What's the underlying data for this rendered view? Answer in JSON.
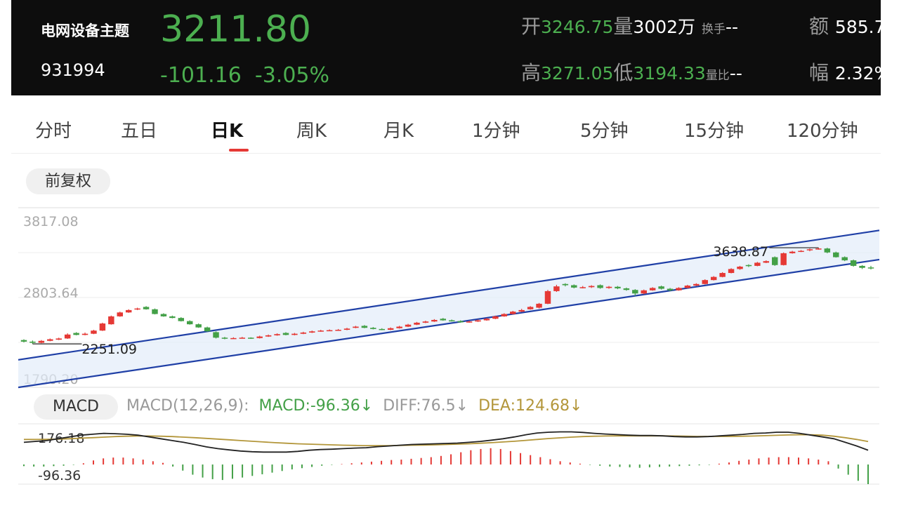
{
  "header": {
    "name": "电网设备主题",
    "code": "931994",
    "price": "3211.80",
    "change": "-101.16",
    "change_pct": "-3.05%",
    "open_label": "开",
    "open": "3246.75",
    "volume_label": "量",
    "volume": "3002万",
    "turnover_label": "换手",
    "turnover": "--",
    "amount_label": "额",
    "amount": "585.7",
    "high_label": "高",
    "high": "3271.05",
    "low_label": "低",
    "low": "3194.33",
    "vol_ratio_label": "量比",
    "vol_ratio": "--",
    "amplitude_label": "幅",
    "amplitude": "2.32%"
  },
  "tabs": [
    "分时",
    "五日",
    "日K",
    "周K",
    "月K",
    "1分钟",
    "5分钟",
    "15分钟",
    "120分钟"
  ],
  "active_tab": "日K",
  "adjust_label": "前复权",
  "colors": {
    "up": "#e53935",
    "down": "#43a047",
    "channel": "#1f3fa6",
    "diff": "#222222",
    "dea": "#b3963a"
  },
  "chart_data": [
    {
      "type": "candlestick",
      "ylim": [
        1790.2,
        3817.08
      ],
      "y_tick_labels": [
        "3817.08",
        "2803.64",
        "1790.20"
      ],
      "annotations": {
        "high": "3638.87",
        "low": "2251.09"
      },
      "trend_channel": {
        "upper": [
          [
            0,
            2050
          ],
          [
            100,
            3690
          ]
        ],
        "lower": [
          [
            0,
            1700
          ],
          [
            100,
            3320
          ]
        ]
      },
      "closes": [
        2280,
        2265,
        2290,
        2310,
        2320,
        2370,
        2365,
        2380,
        2420,
        2510,
        2600,
        2650,
        2680,
        2700,
        2690,
        2630,
        2600,
        2580,
        2540,
        2500,
        2460,
        2410,
        2330,
        2320,
        2325,
        2330,
        2320,
        2345,
        2360,
        2375,
        2365,
        2380,
        2395,
        2410,
        2420,
        2425,
        2430,
        2445,
        2470,
        2455,
        2440,
        2430,
        2450,
        2470,
        2495,
        2520,
        2535,
        2555,
        2550,
        2540,
        2525,
        2535,
        2550,
        2570,
        2600,
        2630,
        2660,
        2680,
        2720,
        2760,
        2920,
        2980,
        2995,
        2965,
        2970,
        2985,
        2960,
        2975,
        2955,
        2935,
        2890,
        2930,
        2960,
        2950,
        2930,
        2960,
        2990,
        3010,
        3060,
        3100,
        3150,
        3200,
        3230,
        3240,
        3280,
        3300,
        3250,
        3400,
        3420,
        3430,
        3450,
        3460,
        3410,
        3350,
        3310,
        3240,
        3215,
        3211.8
      ],
      "opens": [
        2300,
        2280,
        2265,
        2290,
        2305,
        2320,
        2390,
        2365,
        2380,
        2420,
        2500,
        2600,
        2650,
        2690,
        2720,
        2690,
        2630,
        2600,
        2580,
        2540,
        2500,
        2460,
        2400,
        2330,
        2320,
        2325,
        2330,
        2325,
        2345,
        2360,
        2390,
        2365,
        2380,
        2395,
        2410,
        2420,
        2425,
        2430,
        2455,
        2480,
        2455,
        2440,
        2430,
        2450,
        2470,
        2495,
        2520,
        2535,
        2570,
        2550,
        2540,
        2525,
        2535,
        2550,
        2570,
        2600,
        2630,
        2660,
        2690,
        2710,
        2760,
        2920,
        3010,
        2995,
        2965,
        2970,
        2995,
        2960,
        2975,
        2955,
        2935,
        2890,
        2930,
        2980,
        2950,
        2930,
        2960,
        2990,
        3010,
        3060,
        3100,
        3150,
        3200,
        3250,
        3240,
        3280,
        3350,
        3250,
        3400,
        3420,
        3440,
        3450,
        3460,
        3410,
        3350,
        3310,
        3240,
        3220
      ],
      "highs": [
        2310,
        2295,
        2300,
        2320,
        2330,
        2385,
        2400,
        2395,
        2430,
        2520,
        2610,
        2660,
        2690,
        2710,
        2730,
        2700,
        2640,
        2610,
        2590,
        2550,
        2510,
        2470,
        2410,
        2340,
        2335,
        2340,
        2335,
        2355,
        2370,
        2385,
        2400,
        2390,
        2405,
        2420,
        2430,
        2435,
        2440,
        2455,
        2480,
        2490,
        2465,
        2450,
        2460,
        2480,
        2505,
        2530,
        2545,
        2565,
        2580,
        2560,
        2550,
        2545,
        2560,
        2580,
        2610,
        2640,
        2670,
        2695,
        2730,
        2770,
        2935,
        3000,
        3020,
        3005,
        2985,
        2995,
        3005,
        2985,
        2985,
        2965,
        2945,
        2940,
        2970,
        2990,
        2960,
        2970,
        3000,
        3020,
        3070,
        3110,
        3160,
        3210,
        3240,
        3260,
        3290,
        3310,
        3360,
        3410,
        3430,
        3440,
        3460,
        3470,
        3470,
        3420,
        3360,
        3320,
        3250,
        3240
      ],
      "lows": [
        2270,
        2251.09,
        2260,
        2285,
        2300,
        2315,
        2360,
        2360,
        2375,
        2415,
        2495,
        2595,
        2645,
        2680,
        2685,
        2625,
        2595,
        2575,
        2535,
        2495,
        2455,
        2405,
        2320,
        2310,
        2315,
        2320,
        2315,
        2320,
        2340,
        2355,
        2360,
        2360,
        2375,
        2390,
        2405,
        2415,
        2420,
        2425,
        2450,
        2450,
        2435,
        2425,
        2425,
        2445,
        2465,
        2490,
        2515,
        2530,
        2545,
        2535,
        2520,
        2520,
        2530,
        2545,
        2565,
        2595,
        2625,
        2655,
        2685,
        2700,
        2755,
        2910,
        2980,
        2955,
        2955,
        2960,
        2950,
        2950,
        2945,
        2925,
        2860,
        2880,
        2925,
        2940,
        2920,
        2925,
        2955,
        2985,
        3005,
        3055,
        3095,
        3145,
        3190,
        3225,
        3235,
        3275,
        3240,
        3245,
        3395,
        3415,
        3425,
        3445,
        3400,
        3345,
        3300,
        3230,
        3200,
        3194.33
      ]
    },
    {
      "type": "macd",
      "title": "MACD(12,26,9):",
      "macd_label": "MACD:-96.36↓",
      "diff_label": "DIFF:76.5↓",
      "dea_label": "DEA:124.68↓",
      "ylim": [
        -96.36,
        176.18
      ],
      "y_tick_labels": [
        "176.18",
        "-96.36"
      ],
      "diff": [
        120,
        125,
        130,
        140,
        150,
        160,
        165,
        170,
        168,
        165,
        160,
        150,
        140,
        130,
        120,
        108,
        95,
        85,
        78,
        72,
        68,
        66,
        66,
        66,
        70,
        76,
        80,
        82,
        85,
        88,
        90,
        96,
        100,
        104,
        108,
        110,
        112,
        114,
        116,
        120,
        125,
        132,
        140,
        150,
        162,
        172,
        176,
        178,
        178,
        175,
        170,
        166,
        163,
        160,
        158,
        158,
        156,
        152,
        150,
        150,
        152,
        156,
        160,
        164,
        170,
        172,
        176,
        176.18,
        170,
        160,
        150,
        140,
        120,
        100,
        76.5
      ],
      "dea": [
        136,
        136,
        137,
        138,
        140,
        143,
        146,
        149,
        152,
        154,
        155,
        155,
        154,
        152,
        149,
        146,
        142,
        138,
        134,
        130,
        126,
        122,
        118,
        115,
        112,
        110,
        108,
        106,
        104,
        103,
        102,
        102,
        102,
        103,
        104,
        105,
        106,
        108,
        110,
        112,
        115,
        118,
        122,
        126,
        131,
        136,
        141,
        145,
        149,
        152,
        154,
        155,
        156,
        156,
        156,
        156,
        156,
        155,
        154,
        153,
        153,
        153,
        153,
        154,
        155,
        157,
        159,
        161,
        162,
        162,
        160,
        154,
        146,
        136,
        124.68
      ],
      "macd_bars": [
        -8,
        -10,
        -10,
        -8,
        -6,
        -2,
        6,
        20,
        30,
        34,
        34,
        30,
        24,
        16,
        8,
        -10,
        -30,
        -50,
        -64,
        -72,
        -76,
        -70,
        -64,
        -56,
        -48,
        -40,
        -32,
        -24,
        -18,
        -12,
        -6,
        -2,
        2,
        6,
        10,
        14,
        18,
        22,
        24,
        28,
        32,
        36,
        42,
        50,
        60,
        70,
        76,
        80,
        76,
        66,
        56,
        46,
        36,
        26,
        16,
        10,
        4,
        -2,
        -6,
        -10,
        -12,
        -14,
        -16,
        -14,
        -12,
        -10,
        -8,
        -6,
        -4,
        -2,
        4,
        10,
        18,
        24,
        30,
        34,
        36,
        36,
        34,
        30,
        24,
        16,
        -20,
        -50,
        -80,
        -96.36
      ]
    }
  ]
}
